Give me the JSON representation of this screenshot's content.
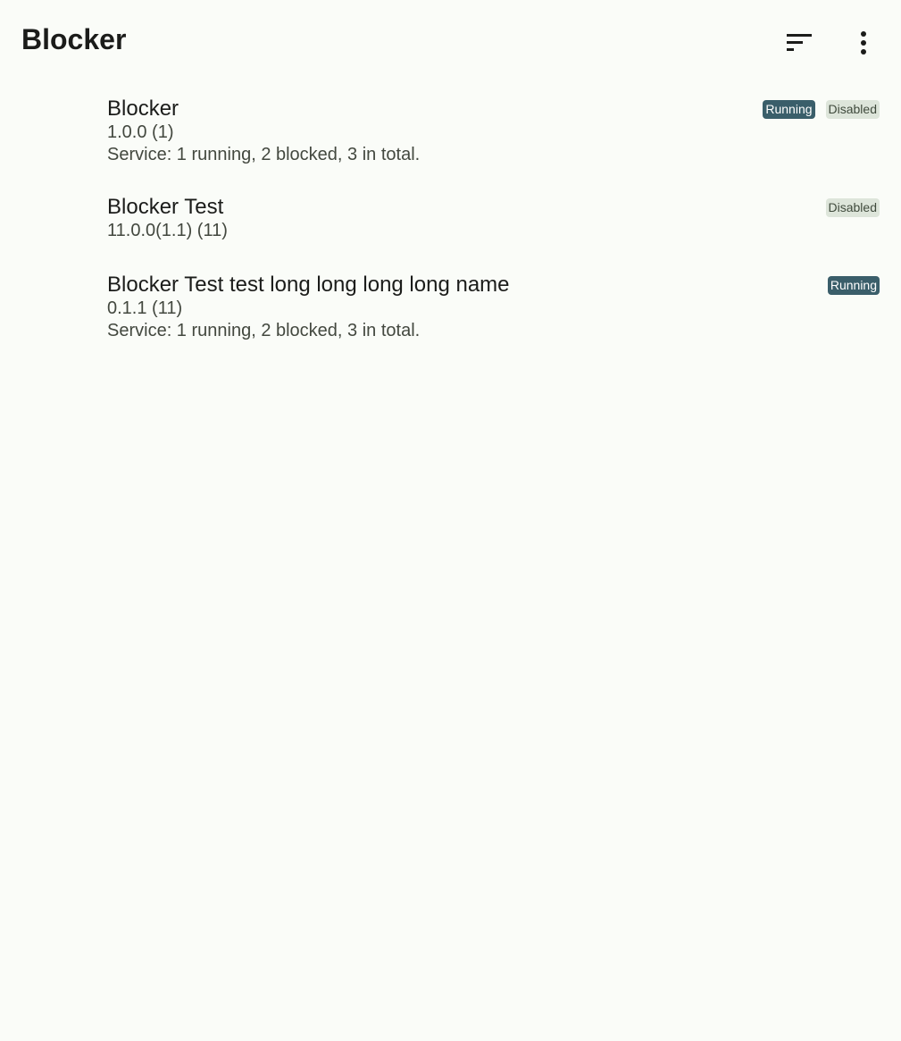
{
  "top_bar": {
    "title": "Blocker",
    "sort_icon": "sort-icon",
    "more_icon": "more-vert-icon"
  },
  "apps": [
    {
      "name": "Blocker",
      "version": "1.0.0 (1)",
      "service": "Service: 1 running, 2 blocked, 3 in total.",
      "badges": [
        "Running",
        "Disabled"
      ]
    },
    {
      "name": "Blocker Test",
      "version": "11.0.0(1.1) (11)",
      "badges": [
        "Disabled"
      ]
    },
    {
      "name": "Blocker Test test long long long long name",
      "version": "0.1.1 (11)",
      "service": "Service: 1 running, 2 blocked, 3 in total.",
      "badges": [
        "Running"
      ]
    }
  ],
  "colors": {
    "background": "#fafcf8",
    "running_badge": "#3a5e6a",
    "disabled_badge": "#dde5da"
  }
}
